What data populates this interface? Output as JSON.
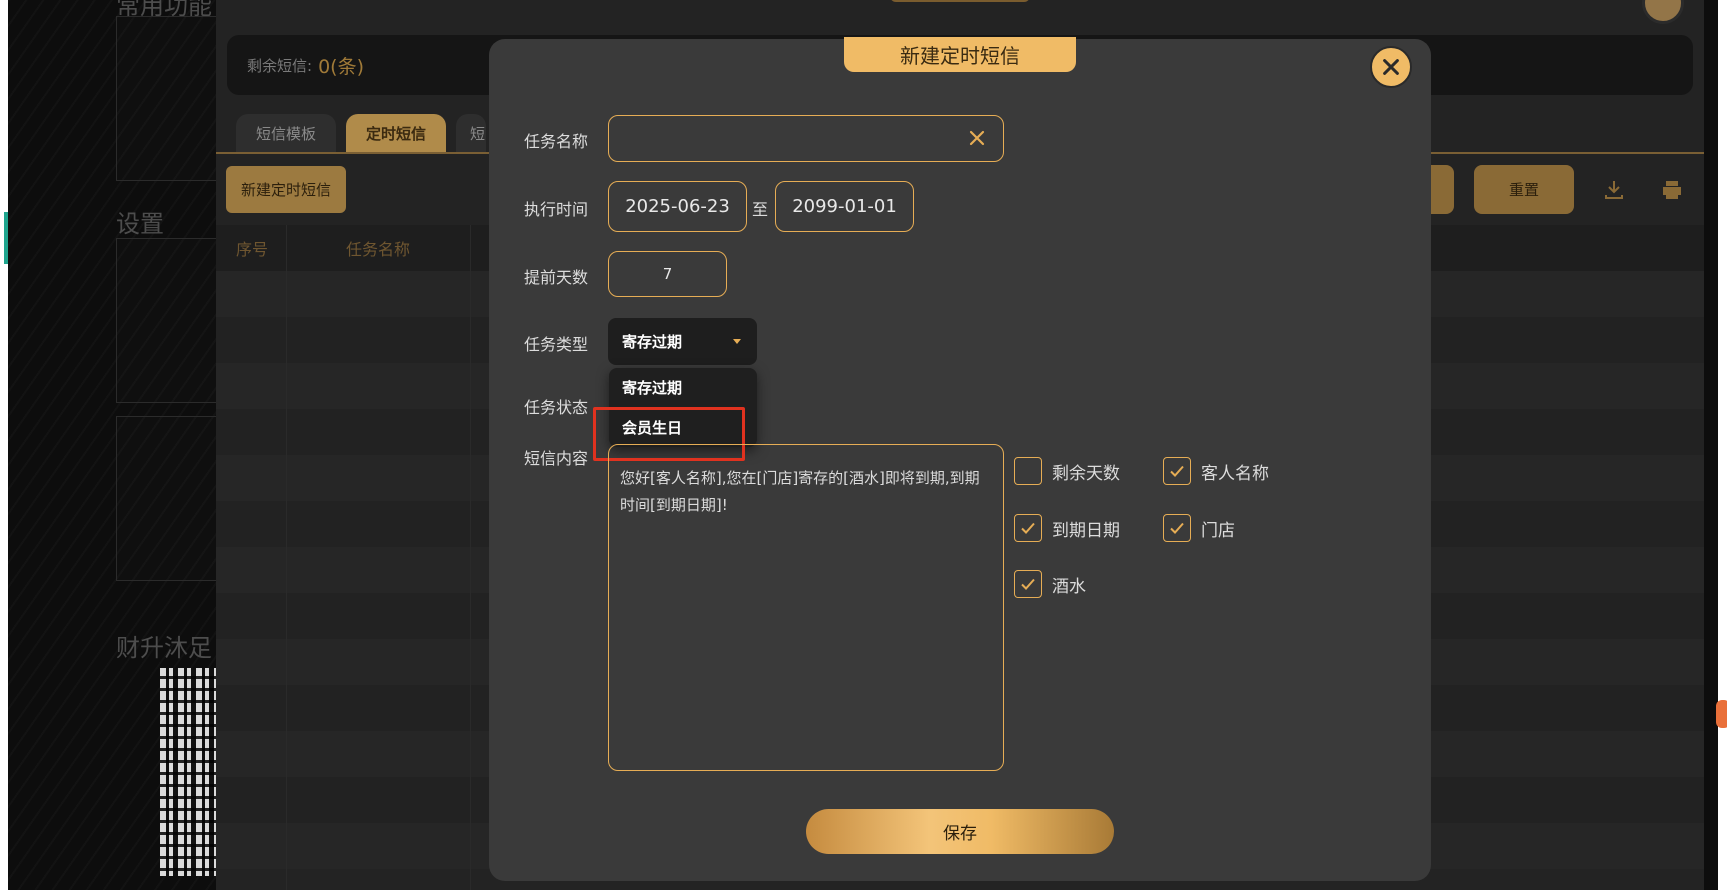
{
  "background": {
    "heading_top": "常用功能",
    "heading_settings": "设置",
    "heading_store": "财升沐足"
  },
  "panel": {
    "remain_label": "剩余短信:",
    "remain_value": "0(条)",
    "tabs": [
      "短信模板",
      "定时短信",
      "短"
    ],
    "new_button": "新建定时短信",
    "reset_button": "重置",
    "table_headers": [
      "序号",
      "任务名称"
    ]
  },
  "modal": {
    "title": "新建定时短信",
    "fields": {
      "task_name_label": "任务名称",
      "task_name_value": "",
      "exec_time_label": "执行时间",
      "date_start": "2025-06-23",
      "date_separator": "至",
      "date_end": "2099-01-01",
      "advance_days_label": "提前天数",
      "advance_days_value": "7",
      "task_type_label": "任务类型",
      "task_type_selected": "寄存过期",
      "task_status_label": "任务状态",
      "sms_content_label": "短信内容",
      "sms_content_value": "您好[客人名称],您在[门店]寄存的[酒水]即将到期,到期时间[到期日期]!"
    },
    "dropdown_options": [
      "寄存过期",
      "会员生日"
    ],
    "checkboxes": [
      {
        "label": "剩余天数",
        "checked": false
      },
      {
        "label": "客人名称",
        "checked": true
      },
      {
        "label": "到期日期",
        "checked": true
      },
      {
        "label": "门店",
        "checked": true
      },
      {
        "label": "酒水",
        "checked": false
      }
    ],
    "save_button": "保存"
  },
  "colors": {
    "accent_gold": "#f0bb66",
    "field_border": "#e6ad55",
    "modal_bg": "#3a3a3a",
    "highlight_red": "#e0321f"
  }
}
